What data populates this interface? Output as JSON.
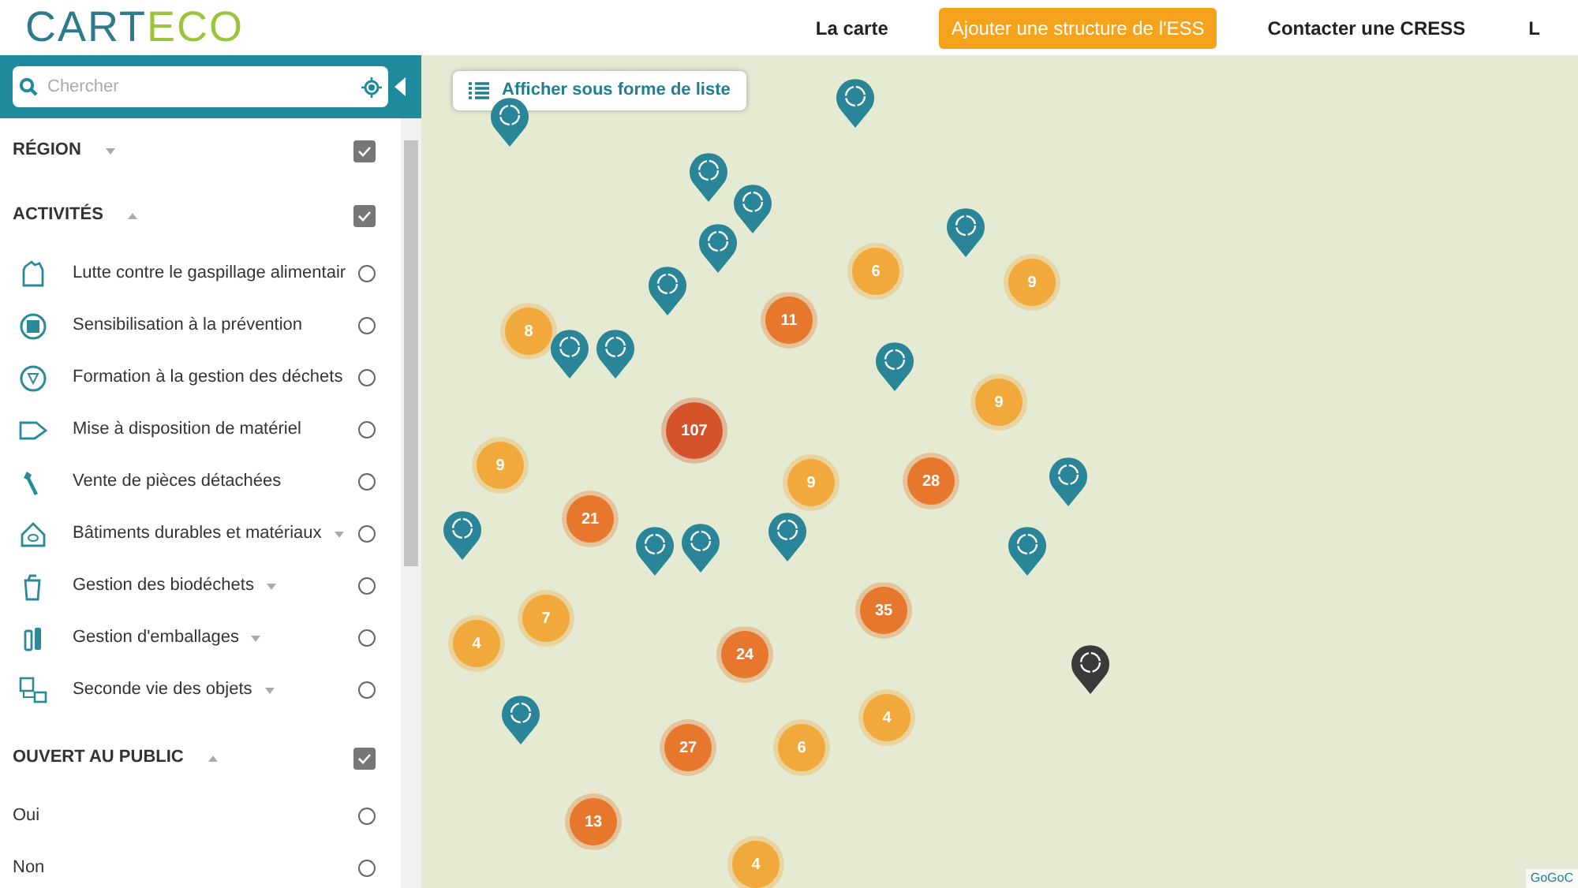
{
  "header": {
    "logo": [
      "CART",
      "ECO"
    ],
    "nav": [
      {
        "label": "La carte",
        "highlighted": false
      },
      {
        "label": "Ajouter une structure de l'ESS",
        "highlighted": true
      },
      {
        "label": "Contacter une CRESS",
        "highlighted": false
      },
      {
        "label": "L",
        "highlighted": false
      }
    ]
  },
  "sidebar": {
    "search": {
      "placeholder": "Chercher"
    },
    "sections": [
      {
        "title": "RÉGION",
        "expanded": false,
        "checked": true
      },
      {
        "title": "ACTIVITÉS",
        "expanded": true,
        "checked": true,
        "items": [
          {
            "label": "Lutte contre le gaspillage alimentair",
            "has_submenu": false,
            "selected": false
          },
          {
            "label": "Sensibilisation à la prévention",
            "has_submenu": false,
            "selected": false
          },
          {
            "label": "Formation à la gestion des déchets",
            "has_submenu": false,
            "selected": false
          },
          {
            "label": "Mise à disposition de matériel",
            "has_submenu": false,
            "selected": false
          },
          {
            "label": "Vente de pièces détachées",
            "has_submenu": false,
            "selected": false
          },
          {
            "label": "Bâtiments durables et matériaux",
            "has_submenu": true,
            "selected": false
          },
          {
            "label": "Gestion des biodéchets",
            "has_submenu": true,
            "selected": false
          },
          {
            "label": "Gestion d'emballages",
            "has_submenu": true,
            "selected": false
          },
          {
            "label": "Seconde vie des objets",
            "has_submenu": true,
            "selected": false
          }
        ]
      },
      {
        "title": "OUVERT AU PUBLIC",
        "expanded": true,
        "checked": true,
        "items": [
          {
            "label": "Oui",
            "selected": false
          },
          {
            "label": "Non",
            "selected": false
          }
        ]
      }
    ]
  },
  "map": {
    "list_button": "Afficher sous forme de liste",
    "clusters": [
      {
        "count": "6",
        "color": "#f2a93b"
      },
      {
        "count": "9",
        "color": "#f2a93b"
      },
      {
        "count": "8",
        "color": "#f2a93b"
      },
      {
        "count": "11",
        "color": "#e8772e"
      },
      {
        "count": "107",
        "color": "#d4532b"
      },
      {
        "count": "9",
        "color": "#f2a93b"
      },
      {
        "count": "9",
        "color": "#f2a93b"
      },
      {
        "count": "9",
        "color": "#f2a93b"
      },
      {
        "count": "28",
        "color": "#e8772e"
      },
      {
        "count": "21",
        "color": "#e8772e"
      },
      {
        "count": "7",
        "color": "#f2a93b"
      },
      {
        "count": "4",
        "color": "#f2a93b"
      },
      {
        "count": "35",
        "color": "#e8772e"
      },
      {
        "count": "24",
        "color": "#e8772e"
      },
      {
        "count": "4",
        "color": "#f2a93b"
      },
      {
        "count": "27",
        "color": "#e8772e"
      },
      {
        "count": "6",
        "color": "#f2a93b"
      },
      {
        "count": "13",
        "color": "#e8772e"
      },
      {
        "count": "4",
        "color": "#f2a93b"
      }
    ],
    "pins": [
      {
        "color": "#2a8598"
      },
      {
        "color": "#2a8598"
      },
      {
        "color": "#2a8598"
      },
      {
        "color": "#2a8598"
      },
      {
        "color": "#2a8598"
      },
      {
        "color": "#2a8598"
      },
      {
        "color": "#2a8598"
      },
      {
        "color": "#2a8598"
      },
      {
        "color": "#2a8598"
      },
      {
        "color": "#2a8598"
      },
      {
        "color": "#2a8598"
      },
      {
        "color": "#2a8598"
      },
      {
        "color": "#2a8598"
      },
      {
        "color": "#2a8598"
      },
      {
        "color": "#2a8598"
      },
      {
        "color": "#2a8598"
      },
      {
        "color": "#2a8598"
      },
      {
        "color": "#3a3a3a"
      }
    ],
    "attribution": "GoGoC"
  }
}
